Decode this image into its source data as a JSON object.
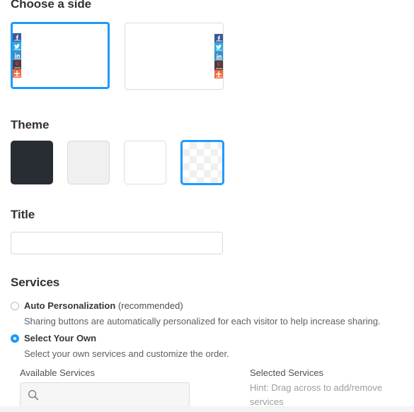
{
  "sections": {
    "choose_side": {
      "heading": "Choose a side",
      "options": [
        {
          "name": "left-side",
          "selected": true,
          "alignment": "left"
        },
        {
          "name": "right-side",
          "selected": false,
          "alignment": "right"
        }
      ],
      "preview_icons": [
        {
          "name": "facebook-icon",
          "label": "Facebook",
          "color": "#3b5998"
        },
        {
          "name": "twitter-icon",
          "label": "Twitter",
          "color": "#29a9e1"
        },
        {
          "name": "linkedin-icon",
          "label": "LinkedIn",
          "color": "#3b8fc4"
        },
        {
          "name": "pinterest-icon",
          "label": "Pinterest",
          "color": "#4c3c3c"
        },
        {
          "name": "sharethis-plus-icon",
          "label": "More",
          "color": "#f2673a"
        }
      ]
    },
    "theme": {
      "heading": "Theme",
      "swatches": [
        {
          "name": "theme-dark",
          "label": "Dark",
          "color": "#282d33",
          "selected": false
        },
        {
          "name": "theme-light-gray",
          "label": "Light Gray",
          "color": "#f0f0f0",
          "selected": false
        },
        {
          "name": "theme-white",
          "label": "White",
          "color": "#ffffff",
          "selected": false
        },
        {
          "name": "theme-transparent",
          "label": "Transparent",
          "color": "transparent",
          "selected": true
        }
      ]
    },
    "title": {
      "heading": "Title",
      "value": "",
      "placeholder": ""
    },
    "services": {
      "heading": "Services",
      "options": [
        {
          "label_strong": "Auto Personalization",
          "label_suffix": " (recommended)",
          "description": "Sharing buttons are automatically personalized for each visitor to help increase sharing.",
          "selected": false
        },
        {
          "label_strong": "Select Your Own",
          "label_suffix": "",
          "description": "Select your own services and customize the order.",
          "selected": true
        }
      ],
      "available_label": "Available Services",
      "search_value": "",
      "search_placeholder": "",
      "selected_label": "Selected Services",
      "selected_hint": "Hint: Drag across to add/remove services"
    }
  },
  "colors": {
    "accent": "#1e9afe",
    "heading": "#2f3337",
    "body_text": "#33363b",
    "muted_text": "#9a9ea3",
    "border": "#dddddd"
  }
}
